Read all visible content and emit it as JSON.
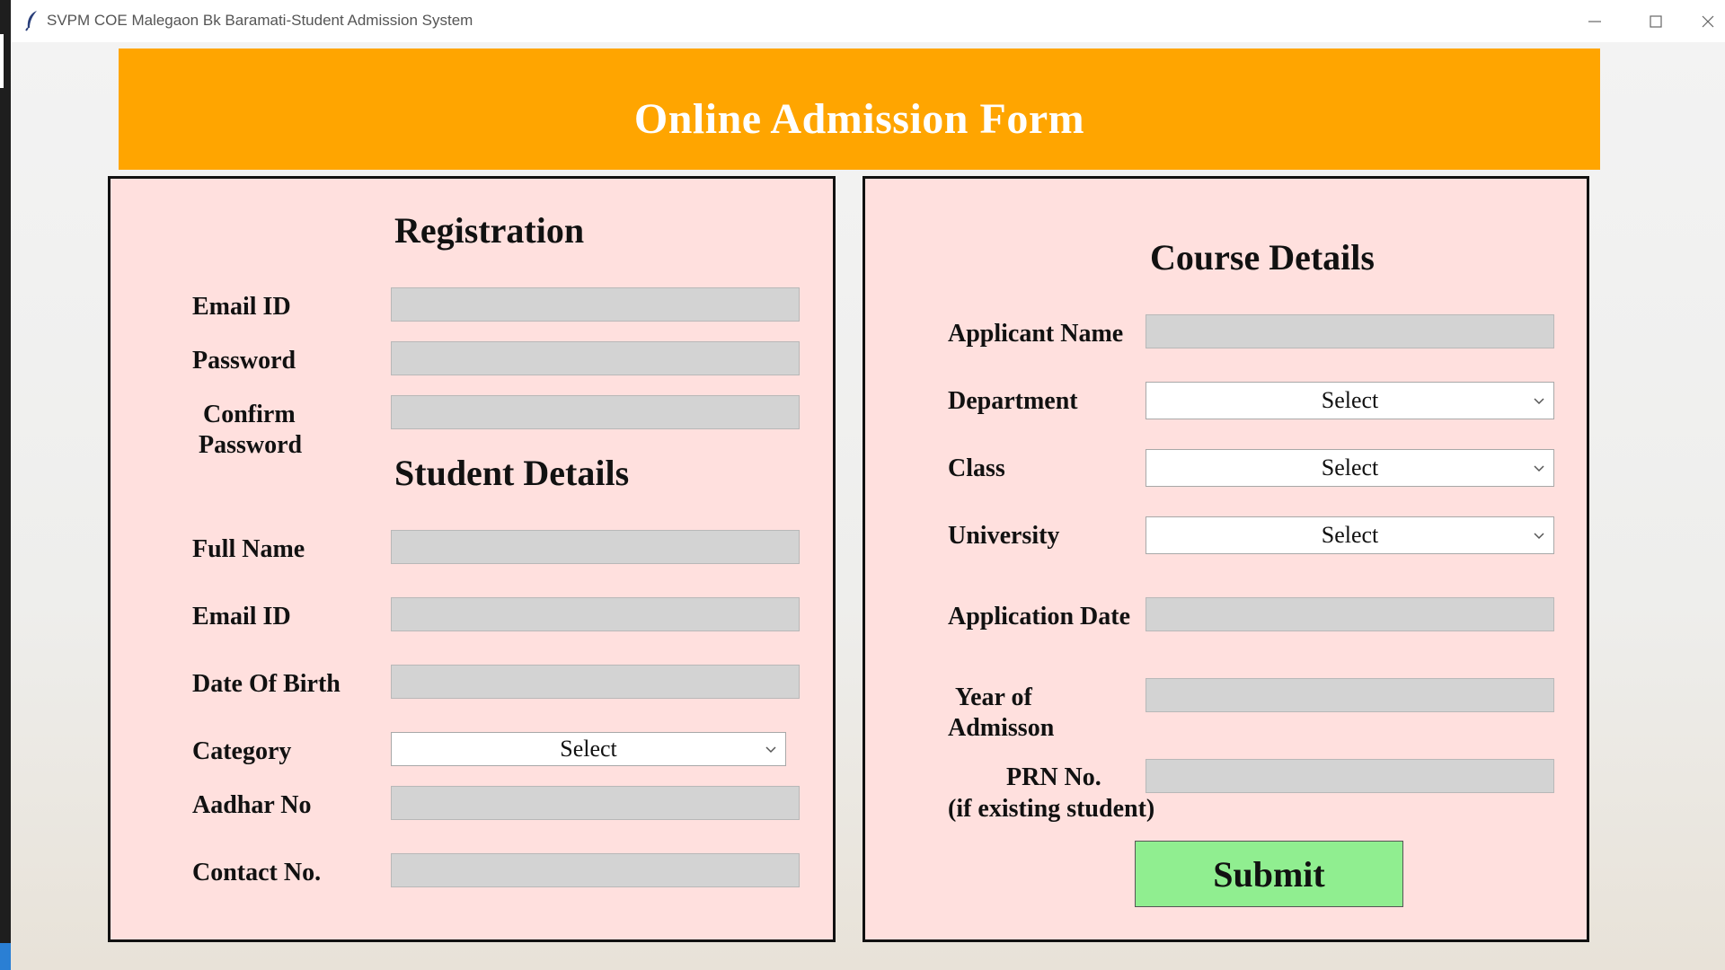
{
  "window": {
    "title": "SVPM COE Malegaon Bk Baramati-Student Admission System",
    "icon": "feather-icon"
  },
  "banner": {
    "title": "Online Admission Form",
    "color": "#ffa500"
  },
  "registration": {
    "heading": "Registration",
    "email_label": "Email ID",
    "password_label": "Password",
    "confirm_label_line1": "Confirm",
    "confirm_label_line2": "Password"
  },
  "student": {
    "heading": "Student Details",
    "full_name_label": "Full Name",
    "email_label": "Email ID",
    "dob_label": "Date Of Birth",
    "category_label": "Category",
    "category_value": "Select",
    "aadhar_label": "Aadhar No",
    "contact_label": "Contact No."
  },
  "course": {
    "heading": "Course Details",
    "applicant_label": "Applicant Name",
    "department_label": "Department",
    "department_value": "Select",
    "class_label": "Class",
    "class_value": "Select",
    "university_label": "University",
    "university_value": "Select",
    "application_date_label": "Application Date",
    "year_label_line1": "Year of",
    "year_label_line2": "Admisson",
    "prn_label_line1": "PRN No.",
    "prn_label_line2": "(if existing student)"
  },
  "submit": {
    "label": "Submit",
    "color": "#90ee90"
  },
  "colors": {
    "panel_bg": "#ffe0de",
    "entry_bg": "#d3d3d3"
  }
}
